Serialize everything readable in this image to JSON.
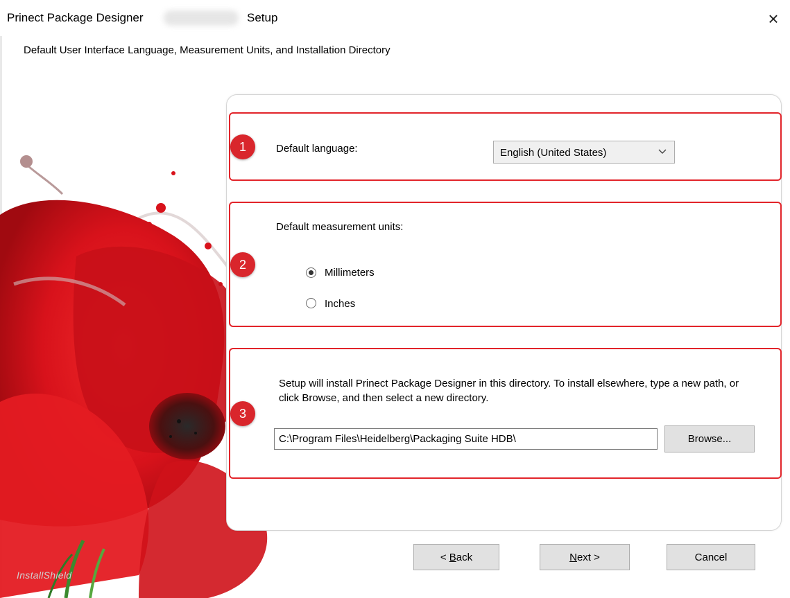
{
  "window": {
    "title_app": "Prinect Package Designer",
    "title_setup": "Setup",
    "close_glyph": "×",
    "subtitle": "Default User Interface Language, Measurement Units, and Installation Directory"
  },
  "section1": {
    "badge": "1",
    "label": "Default language:",
    "selected_language": "English (United States)"
  },
  "section2": {
    "badge": "2",
    "label": "Default measurement units:",
    "options": [
      {
        "label": "Millimeters",
        "selected": true
      },
      {
        "label": "Inches",
        "selected": false
      }
    ]
  },
  "section3": {
    "badge": "3",
    "description": "Setup will install Prinect Package Designer in this directory. To install elsewhere, type a new path, or click Browse, and then select a new directory.",
    "path_value": "C:\\Program Files\\Heidelberg\\Packaging Suite HDB\\",
    "browse_label": "Browse..."
  },
  "footer": {
    "back_prefix": "< ",
    "back_mnemonic": "B",
    "back_rest": "ack",
    "next_mnemonic": "N",
    "next_rest": "ext >",
    "cancel_label": "Cancel",
    "brand": "InstallShield"
  },
  "colors": {
    "highlight_red": "#e2242a",
    "badge_red": "#d9262c",
    "poppy_red": "#d8121b"
  },
  "icons": {
    "close": "close-icon",
    "dropdown": "chevron-down-icon"
  }
}
